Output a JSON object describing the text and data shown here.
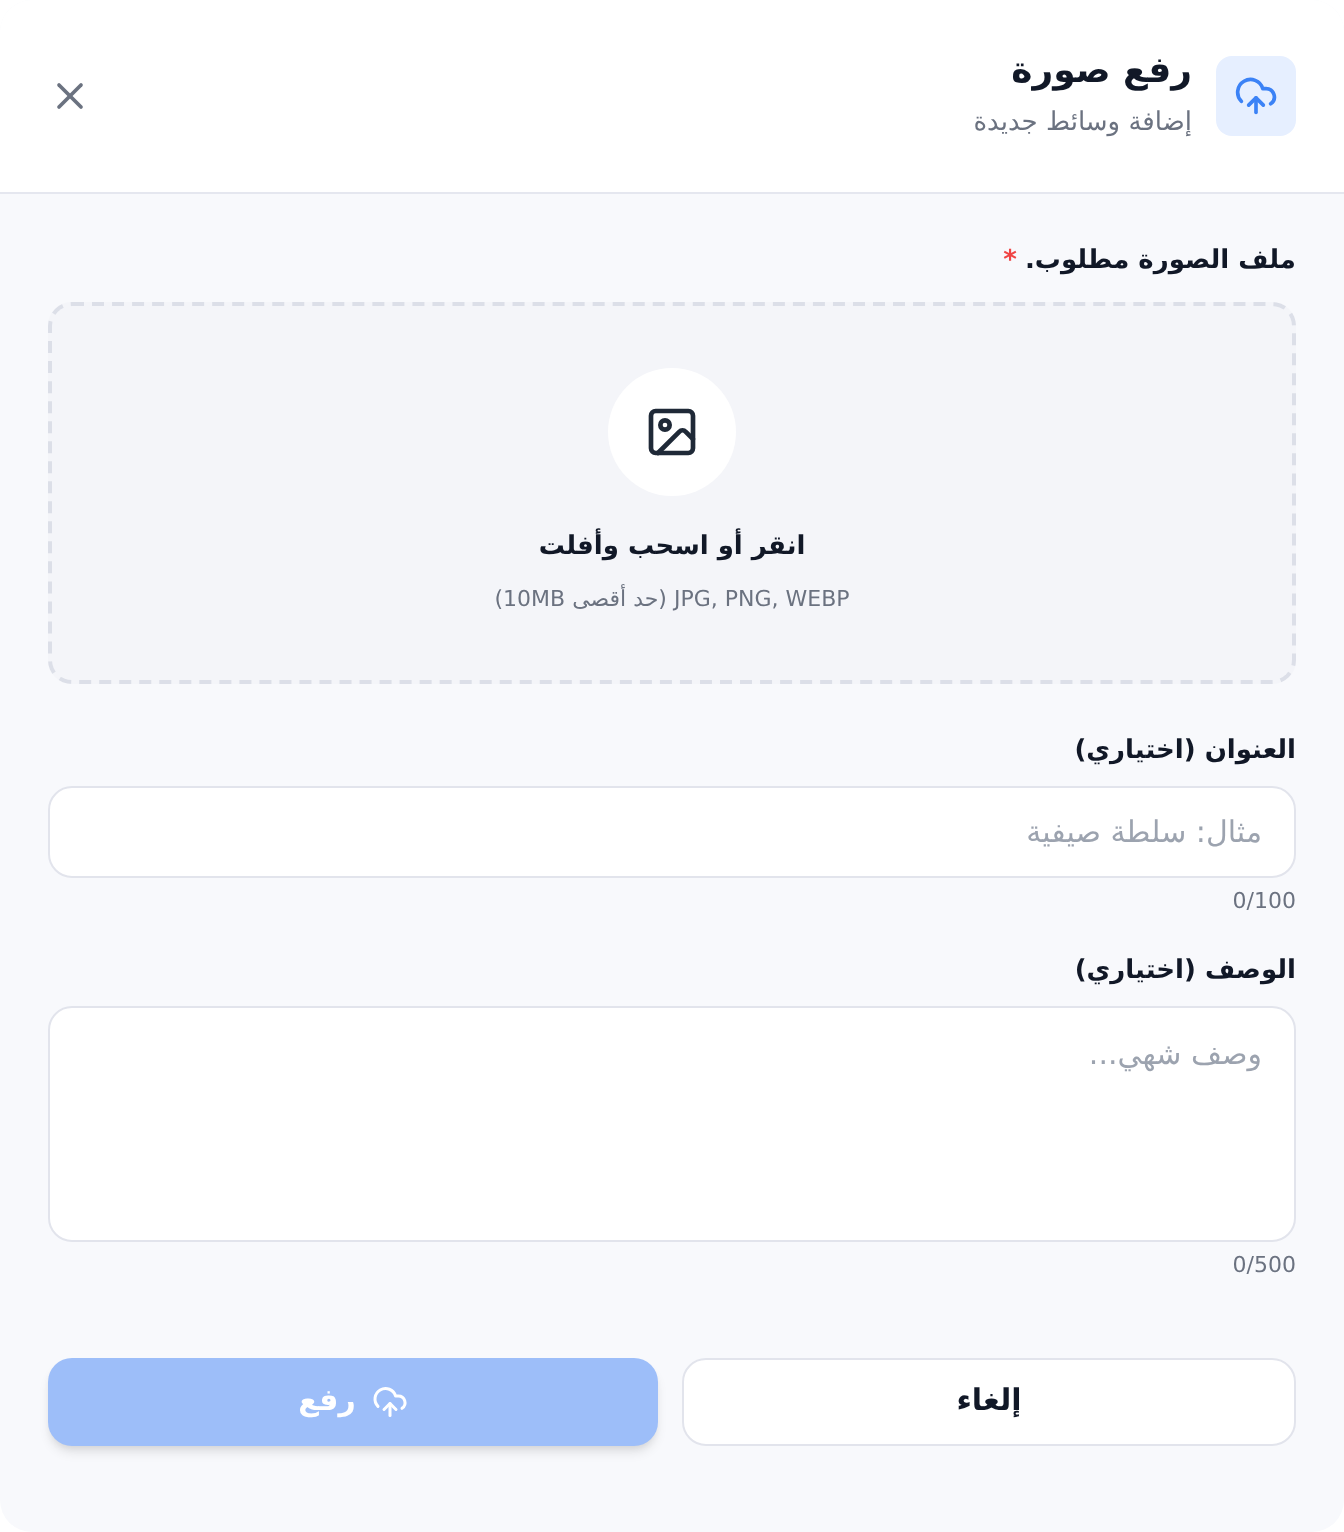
{
  "header": {
    "title": "رفع صورة",
    "subtitle": "إضافة وسائط جديدة"
  },
  "image_field": {
    "label": "ملف الصورة مطلوب.",
    "required_mark": "*",
    "dropzone_title": "انقر أو اسحب وأفلت",
    "dropzone_hint": "JPG, PNG, WEBP (حد أقصى 10MB)"
  },
  "title_field": {
    "label": "العنوان (اختياري)",
    "placeholder": "مثال: سلطة صيفية",
    "counter": "0/100"
  },
  "description_field": {
    "label": "الوصف (اختياري)",
    "placeholder": "وصف شهي...",
    "counter": "0/500"
  },
  "buttons": [
    {
      "kind": "secondary",
      "label": "إلغاء",
      "disabled": false
    },
    {
      "kind": "primary",
      "label": "رفع",
      "disabled": true
    }
  ]
}
